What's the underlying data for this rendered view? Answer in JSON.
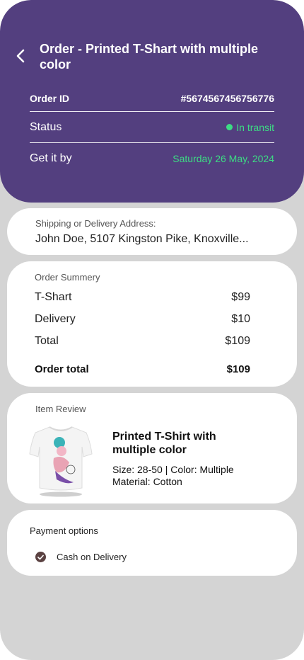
{
  "header": {
    "title": "Order - Printed T-Shart  with multiple color",
    "order_id_label": "Order ID",
    "order_id_value": "#5674567456756776",
    "status_label": "Status",
    "status_value": "In transit",
    "get_it_by_label": "Get it by",
    "get_it_by_value": "Saturday 26 May, 2024"
  },
  "address": {
    "label": "Shipping or Delivery Address:",
    "value": "John Doe, 5107 Kingston Pike, Knoxville..."
  },
  "summary": {
    "label": "Order Summery",
    "items": [
      {
        "name": "T-Shart",
        "amount": "$99"
      },
      {
        "name": "Delivery",
        "amount": "$10"
      },
      {
        "name": "Total",
        "amount": "$109"
      }
    ],
    "order_total_label": "Order total",
    "order_total_value": "$109"
  },
  "item_review": {
    "label": "Item Review",
    "title": "Printed T-Shirt  with multiple color",
    "size_color": "Size: 28-50 | Color: Multiple",
    "material": "Material: Cotton"
  },
  "payment": {
    "label": "Payment options",
    "selected_option": "Cash on Delivery"
  },
  "colors": {
    "header_bg": "#533f7f",
    "status_green": "#3ddc84",
    "page_bg": "#d4d4d4"
  },
  "icons": [
    "back-arrow-icon",
    "status-dot-icon",
    "check-icon"
  ]
}
